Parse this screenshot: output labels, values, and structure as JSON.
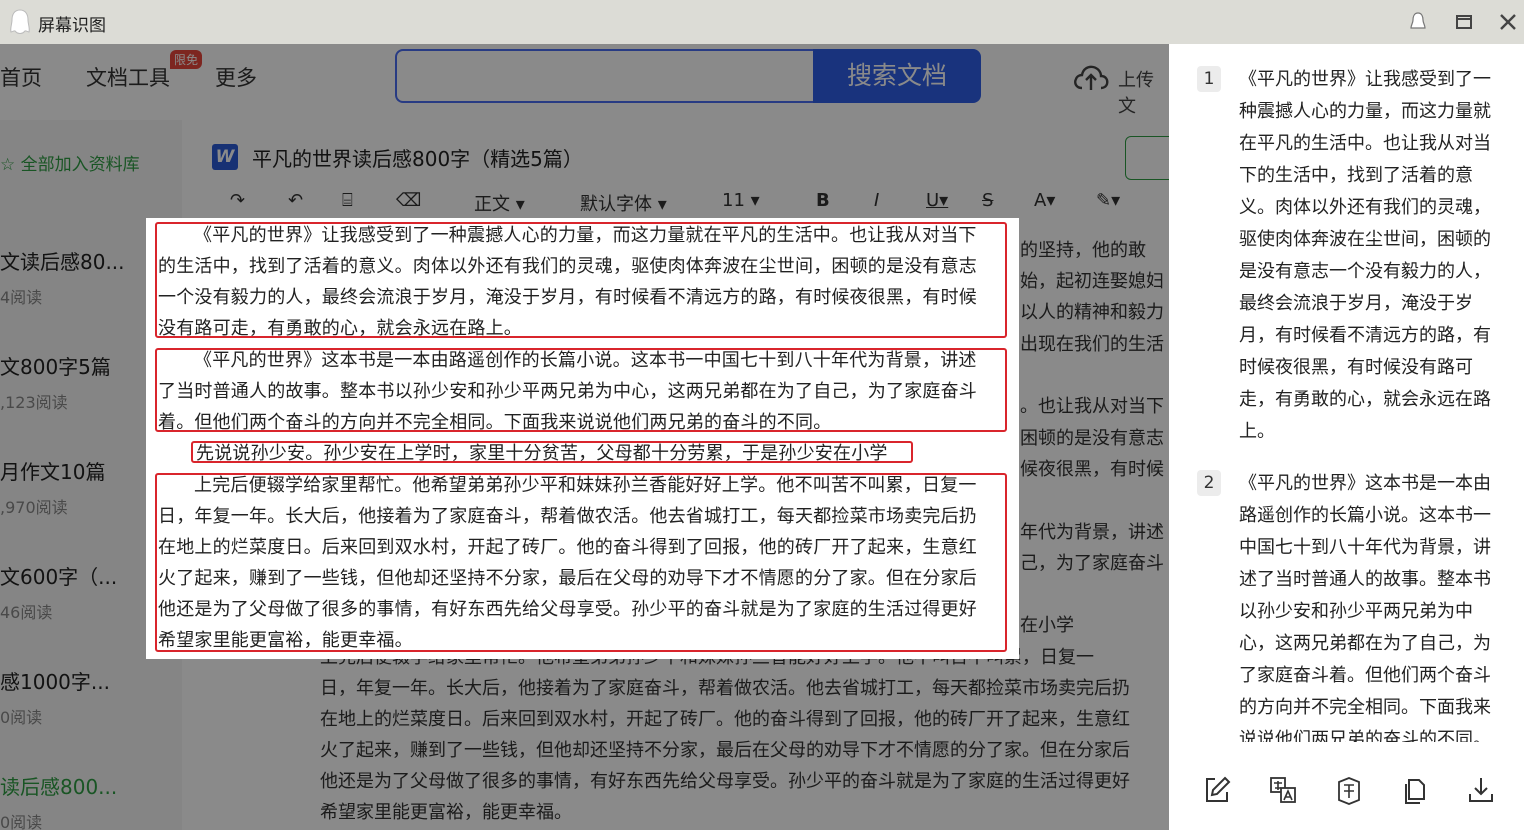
{
  "window": {
    "title": "屏幕识图"
  },
  "background_page": {
    "nav": {
      "home": "首页",
      "doc_tools": "文档工具",
      "doc_tools_badge": "限免",
      "more": "更多",
      "search_button": "搜索文档",
      "upload": "上传文"
    },
    "sidebar": {
      "add_all": "全部加入资料库",
      "items": [
        {
          "title": "文读后感80...",
          "meta": "4阅读"
        },
        {
          "title": "文800字5篇",
          "meta": ",123阅读"
        },
        {
          "title": "月作文10篇",
          "meta": ",970阅读"
        },
        {
          "title": "文600字（...",
          "meta": "46阅读"
        },
        {
          "title": "感1000字...",
          "meta": "0阅读"
        },
        {
          "title": "读后感800...",
          "meta": "0阅读"
        }
      ]
    },
    "document": {
      "title": "平凡的世界读后感800字（精选5篇）",
      "toolbar": {
        "style": "正文",
        "font": "默认字体",
        "size": "11"
      },
      "right_fragments": [
        "的坚持，他的敢",
        "始，起初连娶媳妇",
        "以人的精神和毅力",
        "出现在我们的生活",
        "。也让我从对当下",
        "困顿的是没有意志",
        "候夜很黑，有时候",
        "年代为背景，讲述",
        "己，为了家庭奋斗",
        "在小学"
      ],
      "bottom_lines": [
        "上完后便辍学给家里帮忙。他希望弟弟孙少平和妹妹孙兰香能好好上学。他不叫苦不叫累，日复一",
        "日，年复一年。长大后，他接着为了家庭奋斗，帮着做农活。他去省城打工，每天都捡菜市场卖完后扔",
        "在地上的烂菜度日。后来回到双水村，开起了砖厂。他的奋斗得到了回报，他的砖厂开了起来，生意红",
        "火了起来，赚到了一些钱，但他却还坚持不分家，最后在父母的劝导下才不情愿的分了家。但在分家后",
        "他还是为了父母做了很多的事情，有好东西先给父母享受。孙少平的奋斗就是为了家庭的生活过得更好",
        "希望家里能更富裕，能更幸福。"
      ]
    }
  },
  "capture": {
    "paragraphs": [
      {
        "lines": [
          "《平凡的世界》让我感受到了一种震撼人心的力量，而这力量就在平凡的生活中。也让我从对当下",
          "的生活中，找到了活着的意义。肉体以外还有我们的灵魂，驱使肉体奔波在尘世间，困顿的是没有意志",
          "一个没有毅力的人，最终会流浪于岁月，淹没于岁月，有时候看不清远方的路，有时候夜很黑，有时候",
          "没有路可走，有勇敢的心，就会永远在路上。"
        ]
      },
      {
        "lines": [
          "《平凡的世界》这本书是一本由路遥创作的长篇小说。这本书一中国七十到八十年代为背景，讲述",
          "了当时普通人的故事。整本书以孙少安和孙少平两兄弟为中心，这两兄弟都在为了自己，为了家庭奋斗",
          "着。但他们两个奋斗的方向并不完全相同。下面我来说说他们两兄弟的奋斗的不同。"
        ]
      },
      {
        "lines": [
          "先说说孙少安。孙少安在上学时，家里十分贫苦，父母都十分劳累，于是孙少安在小学"
        ]
      },
      {
        "lines": [
          "上完后便辍学给家里帮忙。他希望弟弟孙少平和妹妹孙兰香能好好上学。他不叫苦不叫累，日复一",
          "日，年复一年。长大后，他接着为了家庭奋斗，帮着做农活。他去省城打工，每天都捡菜市场卖完后扔",
          "在地上的烂菜度日。后来回到双水村，开起了砖厂。他的奋斗得到了回报，他的砖厂开了起来，生意红",
          "火了起来，赚到了一些钱，但他却还坚持不分家，最后在父母的劝导下才不情愿的分了家。但在分家后",
          "他还是为了父母做了很多的事情，有好东西先给父母享受。孙少平的奋斗就是为了家庭的生活过得更好",
          "希望家里能更富裕，能更幸福。"
        ]
      }
    ]
  },
  "results": [
    {
      "num": "1",
      "text": "《平凡的世界》让我感受到了一种震撼人心的力量，而这力量就在平凡的生活中。也让我从对当下的生活中，找到了活着的意义。肉体以外还有我们的灵魂，驱使肉体奔波在尘世间，困顿的是没有意志一个没有毅力的人，最终会流浪于岁月，淹没于岁月，有时候看不清远方的路，有时候夜很黑，有时候没有路可走，有勇敢的心，就会永远在路上。"
    },
    {
      "num": "2",
      "text": "《平凡的世界》这本书是一本由路遥创作的长篇小说。这本书一中国七十到八十年代为背景，讲述了当时普通人的故事。整本书以孙少安和孙少平两兄弟为中心，这两兄弟都在为了自己，为了家庭奋斗着。但他们两个奋斗的方向并不完全相同。下面我来说说他们两兄弟的奋斗的不同。"
    }
  ],
  "colors": {
    "highlight_box": "#d9252c",
    "accent_blue": "#2f5fe8",
    "accent_green": "#2f9e44"
  },
  "panel_tools": [
    "edit-icon",
    "translate-icon",
    "text-extract-icon",
    "copy-icon",
    "download-icon"
  ]
}
